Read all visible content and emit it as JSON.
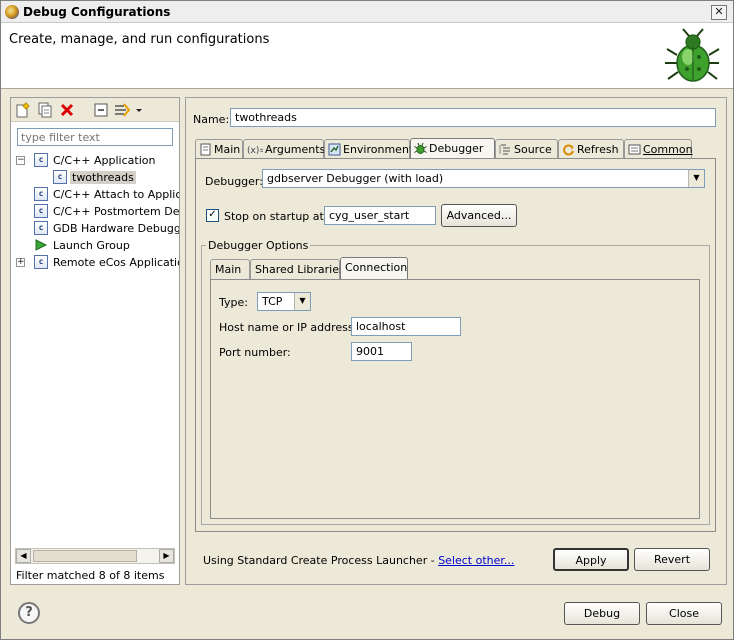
{
  "window": {
    "title": "Debug Configurations",
    "close_glyph": "✕",
    "banner_heading": "Create, manage, and run configurations",
    "banner_icon": "bug-icon"
  },
  "left": {
    "toolbar_icons": [
      "new-config-icon",
      "duplicate-icon",
      "delete-icon",
      "collapse-all-icon",
      "filter-icon",
      "dropdown-arrow-icon"
    ],
    "filter_placeholder": "type filter text",
    "tree": [
      {
        "label": "C/C++ Application",
        "expanded": true,
        "level": 0,
        "icon": "c-app-icon"
      },
      {
        "label": "twothreads",
        "level": 1,
        "selected": true,
        "icon": "c-app-icon"
      },
      {
        "label": "C/C++ Attach to Applica",
        "level": 0,
        "icon": "c-app-icon"
      },
      {
        "label": "C/C++ Postmortem Debu",
        "level": 0,
        "icon": "c-app-icon"
      },
      {
        "label": "GDB Hardware Debuggin",
        "level": 0,
        "icon": "c-app-icon"
      },
      {
        "label": "Launch Group",
        "level": 0,
        "icon": "launch-arrow-icon"
      },
      {
        "label": "Remote eCos Application",
        "level": 0,
        "collapsed": true,
        "icon": "c-app-icon"
      }
    ],
    "scroll_left": "◀",
    "scroll_right": "▶",
    "status": "Filter matched 8 of 8 items"
  },
  "right": {
    "name_label": "Name:",
    "name_value": "twothreads",
    "tabs": [
      {
        "label": "Main",
        "icon": "main-tab-icon"
      },
      {
        "label": "Arguments",
        "icon": "arguments-icon"
      },
      {
        "label": "Environment",
        "icon": "environment-icon"
      },
      {
        "label": "Debugger",
        "icon": "debugger-bug-icon",
        "active": true
      },
      {
        "label": "Source",
        "icon": "source-icon"
      },
      {
        "label": "Refresh",
        "icon": "refresh-icon"
      },
      {
        "label": "Common",
        "icon": "common-icon"
      }
    ],
    "debugger_label": "Debugger:",
    "debugger_value": "gdbserver Debugger (with load)",
    "stop_label": "Stop on startup at:",
    "stop_checked": "✓",
    "stop_value": "cyg_user_start",
    "advanced_label": "Advanced...",
    "options_title": "Debugger Options",
    "inner_tabs": [
      "Main",
      "Shared Libraries",
      "Connection"
    ],
    "conn": {
      "type_label": "Type:",
      "type_value": "TCP",
      "host_label": "Host name or IP address:",
      "host_value": "localhost",
      "port_label": "Port number:",
      "port_value": "9001"
    },
    "launcher_text": "Using Standard Create Process Launcher - ",
    "launcher_link": "Select other...",
    "apply_label": "Apply",
    "revert_label": "Revert"
  },
  "footer": {
    "help_glyph": "?",
    "debug_label": "Debug",
    "close_label": "Close"
  },
  "dropdown_glyph": "▼"
}
